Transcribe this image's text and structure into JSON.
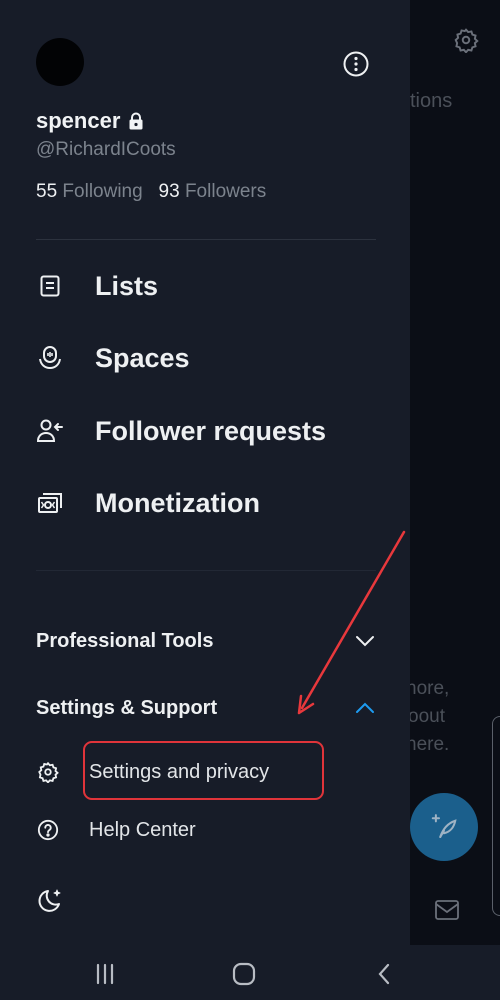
{
  "background_app": {
    "partial_texts": [
      "tions",
      "nore,",
      "oout",
      "nere."
    ],
    "icons": [
      "gear-icon",
      "compose-post-icon",
      "mail-icon"
    ]
  },
  "profile": {
    "display_name": "spencer",
    "locked_icon": "lock-icon",
    "handle": "@RichardICoots",
    "following_count": "55",
    "following_label": "Following",
    "followers_count": "93",
    "followers_label": "Followers",
    "more_icon": "more-options-icon"
  },
  "nav": {
    "items": [
      {
        "label": "Lists",
        "icon": "list-icon"
      },
      {
        "label": "Spaces",
        "icon": "spaces-icon"
      },
      {
        "label": "Follower requests",
        "icon": "follower-requests-icon"
      },
      {
        "label": "Monetization",
        "icon": "monetization-icon"
      }
    ]
  },
  "sections": {
    "professional_tools": {
      "label": "Professional Tools",
      "expanded": false,
      "icon": "chevron-down-icon"
    },
    "settings_support": {
      "label": "Settings & Support",
      "expanded": true,
      "icon": "chevron-up-icon",
      "items": [
        {
          "label": "Settings and privacy",
          "icon": "gear-icon",
          "highlighted": true
        },
        {
          "label": "Help Center",
          "icon": "help-icon"
        }
      ]
    }
  },
  "footer": {
    "theme_icon": "moon-icon"
  },
  "colors": {
    "background": "#171c28",
    "accent": "#1d9bf0",
    "annotation": "#e0343a",
    "muted_text": "#7c838d"
  },
  "system_nav": {
    "buttons": [
      "recents",
      "home",
      "back"
    ]
  }
}
